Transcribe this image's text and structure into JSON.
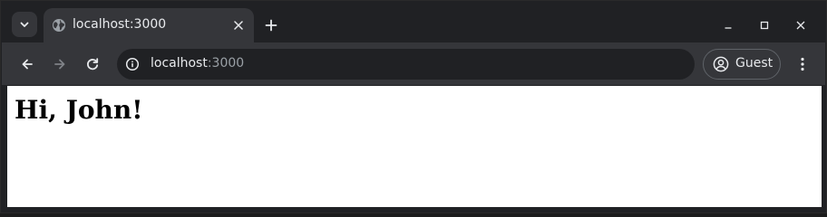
{
  "browser": {
    "tab": {
      "title": "localhost:3000",
      "favicon": "globe-icon"
    },
    "new_tab_icon": "plus-icon",
    "tab_search_icon": "chevron-down-icon",
    "window_controls": [
      "minimize-icon",
      "maximize-icon",
      "close-icon"
    ],
    "toolbar": {
      "back_icon": "arrow-left-icon",
      "forward_icon": "arrow-right-icon",
      "reload_icon": "reload-icon",
      "site_info_icon": "info-icon",
      "url_host": "localhost",
      "url_port": ":3000",
      "profile_label": "Guest",
      "profile_icon": "person-icon",
      "menu_icon": "kebab-menu-icon"
    }
  },
  "page": {
    "heading": "Hi, John!"
  },
  "colors": {
    "frame": "#202124",
    "toolbar": "#35363a",
    "omnibox": "#202124",
    "text": "#e8eaed",
    "muted_text": "#9aa0a6",
    "page_background": "#ffffff"
  }
}
